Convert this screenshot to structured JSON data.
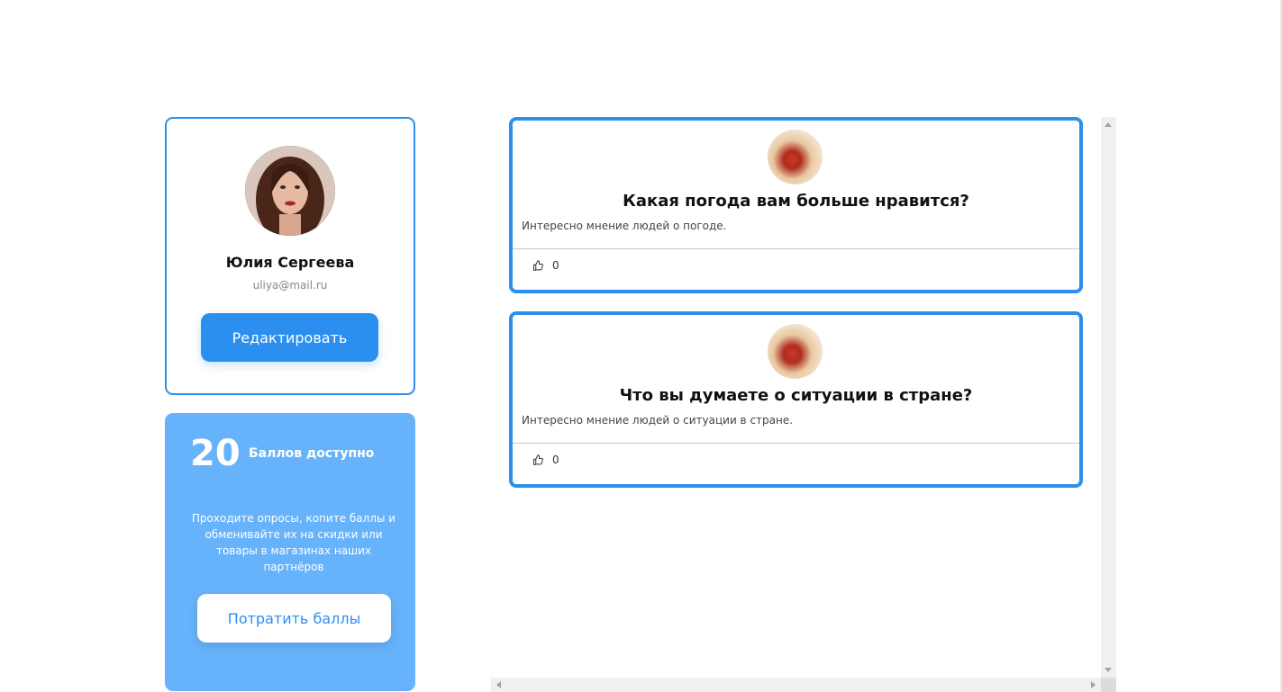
{
  "profile": {
    "name": "Юлия Сергеева",
    "email": "uliya@mail.ru",
    "edit_label": "Редактировать"
  },
  "points": {
    "value": "20",
    "caption": "Баллов доступно",
    "description": "Проходите опросы, копите баллы и обменивайте их на скидки или товары в магазинах наших партнёров",
    "spend_label": "Потратить баллы"
  },
  "surveys": [
    {
      "title": "Какая погода вам больше нравится?",
      "description": "Интересно мнение людей о погоде.",
      "likes": "0"
    },
    {
      "title": "Что вы думаете о ситуации в стране?",
      "description": "Интересно мнение людей о ситуации в стране.",
      "likes": "0"
    }
  ],
  "icons": {
    "like": "thumbs-up-icon",
    "scroll_up": "chevron-up-icon",
    "scroll_down": "chevron-down-icon",
    "scroll_left": "chevron-left-icon",
    "scroll_right": "chevron-right-icon"
  },
  "colors": {
    "accent": "#2b8ff0",
    "card_border": "#2b90ec",
    "points_bg": "#67b3fb"
  }
}
